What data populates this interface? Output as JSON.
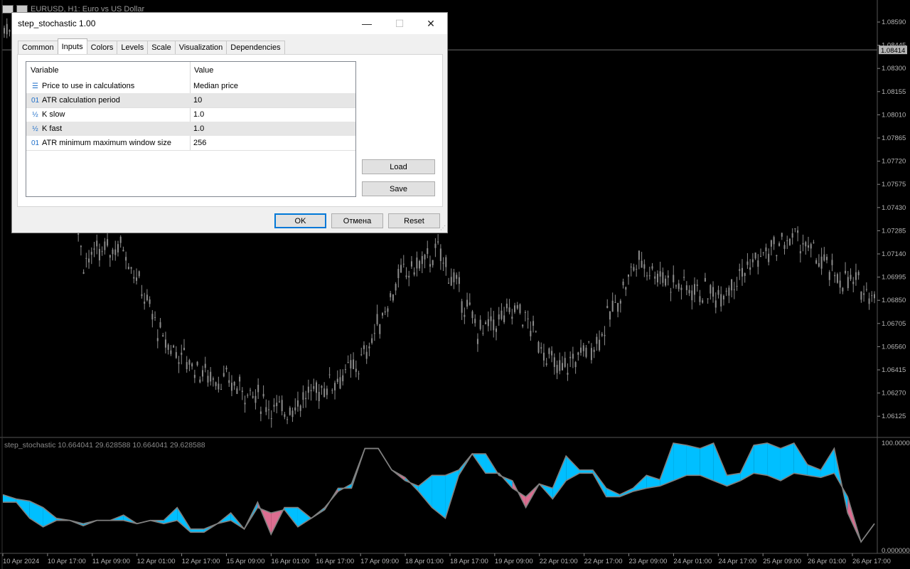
{
  "chart_window": {
    "title": "EURUSD, H1:  Euro vs US Dollar",
    "price_axis": [
      "1.08590",
      "1.08445",
      "1.08300",
      "1.08155",
      "1.08010",
      "1.07865",
      "1.07720",
      "1.07575",
      "1.07430",
      "1.07285",
      "1.07140",
      "1.06995",
      "1.06850",
      "1.06705",
      "1.06560",
      "1.06415",
      "1.06270",
      "1.06125"
    ],
    "current_price": "1.08414",
    "time_axis": [
      "10 Apr 2024",
      "10 Apr 17:00",
      "11 Apr 09:00",
      "12 Apr 01:00",
      "12 Apr 17:00",
      "15 Apr 09:00",
      "16 Apr 01:00",
      "16 Apr 17:00",
      "17 Apr 09:00",
      "18 Apr 01:00",
      "18 Apr 17:00",
      "19 Apr 09:00",
      "22 Apr 01:00",
      "22 Apr 17:00",
      "23 Apr 09:00",
      "24 Apr 01:00",
      "24 Apr 17:00",
      "25 Apr 09:00",
      "26 Apr 01:00",
      "26 Apr 17:00"
    ],
    "indicator_label": "step_stochastic 10.664041 29.628588 10.664041 29.628588",
    "indicator_axis": [
      "100.0000",
      "0.000000"
    ]
  },
  "dialog": {
    "title": "step_stochastic 1.00",
    "controls": {
      "minimize": "—",
      "maximize": "☐",
      "close": "✕"
    },
    "tabs": [
      "Common",
      "Inputs",
      "Colors",
      "Levels",
      "Scale",
      "Visualization",
      "Dependencies"
    ],
    "active_tab": "Inputs",
    "grid_headers": {
      "variable": "Variable",
      "value": "Value"
    },
    "rows": [
      {
        "icon": "enum-icon",
        "icon_glyph": "☰",
        "variable": "Price to use in calculations",
        "value": "Median price"
      },
      {
        "icon": "integer-icon",
        "icon_glyph": "01",
        "variable": "ATR calculation period",
        "value": "10"
      },
      {
        "icon": "double-icon",
        "icon_glyph": "½",
        "variable": "K slow",
        "value": "1.0"
      },
      {
        "icon": "double-icon",
        "icon_glyph": "½",
        "variable": "K fast",
        "value": "1.0"
      },
      {
        "icon": "integer-icon",
        "icon_glyph": "01",
        "variable": "ATR minimum maximum window size",
        "value": "256"
      }
    ],
    "buttons": {
      "load": "Load",
      "save": "Save",
      "ok": "OK",
      "cancel": "Отмена",
      "reset": "Reset"
    }
  },
  "colors": {
    "background": "#000000",
    "candles": "#8c8c8c",
    "fill_up": "#00bfff",
    "fill_down": "#dc6e91",
    "stoch_line": "#808080",
    "grid_text": "#b4b4b4"
  },
  "chart_data": {
    "type": "line",
    "x": [
      "10 Apr 2024",
      "10 Apr 17:00",
      "11 Apr 09:00",
      "12 Apr 01:00",
      "12 Apr 17:00",
      "15 Apr 09:00",
      "16 Apr 01:00",
      "16 Apr 17:00",
      "17 Apr 09:00",
      "18 Apr 01:00",
      "18 Apr 17:00",
      "19 Apr 09:00",
      "22 Apr 01:00",
      "22 Apr 17:00",
      "23 Apr 09:00",
      "24 Apr 01:00",
      "24 Apr 17:00",
      "25 Apr 09:00",
      "26 Apr 01:00",
      "26 Apr 17:00"
    ],
    "series": [
      {
        "values": [
          1.0855,
          1.085,
          1.071,
          1.072,
          1.066,
          1.064,
          1.063,
          1.0615,
          1.063,
          1.0645,
          1.07,
          1.0715,
          1.0665,
          1.068,
          1.064,
          1.066,
          1.071,
          1.0695,
          1.0688,
          1.071,
          1.0725,
          1.07,
          1.069
        ]
      }
    ],
    "ylim": [
      1.0605,
      1.0866
    ],
    "indicator": {
      "ylim": [
        0,
        100
      ],
      "fast": [
        52,
        48,
        46,
        40,
        30,
        28,
        25,
        28,
        28,
        33,
        25,
        28,
        28,
        40,
        20,
        20,
        25,
        35,
        20,
        45,
        15,
        40,
        40,
        30,
        40,
        55,
        62,
        95,
        95,
        75,
        65,
        60,
        70,
        70,
        75,
        90,
        90,
        70,
        65,
        40,
        62,
        58,
        88,
        75,
        75,
        58,
        52,
        58,
        70,
        66,
        100,
        98,
        95,
        100,
        70,
        72,
        98,
        100,
        95,
        100,
        80,
        75,
        95,
        35,
        8,
        25
      ],
      "slow": [
        45,
        45,
        30,
        22,
        28,
        28,
        23,
        28,
        28,
        28,
        25,
        28,
        25,
        28,
        17,
        17,
        25,
        28,
        20,
        40,
        35,
        38,
        22,
        30,
        38,
        58,
        58,
        95,
        95,
        75,
        68,
        55,
        40,
        30,
        70,
        90,
        72,
        72,
        58,
        50,
        62,
        48,
        65,
        72,
        72,
        50,
        50,
        55,
        58,
        60,
        65,
        70,
        70,
        65,
        60,
        65,
        72,
        70,
        65,
        72,
        70,
        68,
        72,
        50,
        8,
        25
      ]
    }
  }
}
